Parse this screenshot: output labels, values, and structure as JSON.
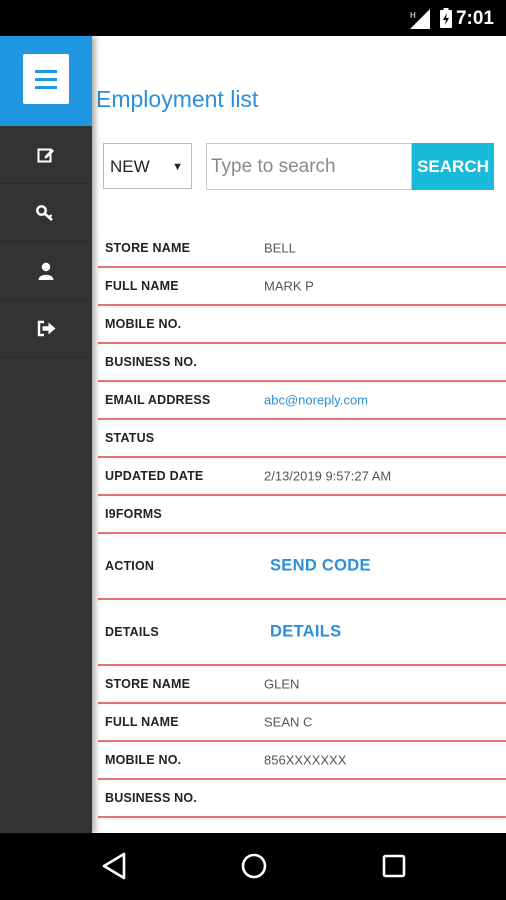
{
  "status_bar": {
    "time": "7:01",
    "icons": [
      "signal-icon",
      "battery-charging-icon"
    ]
  },
  "sidebar": {
    "menu_icon": "hamburger-menu-icon",
    "items": [
      {
        "icon": "edit-icon"
      },
      {
        "icon": "key-icon"
      },
      {
        "icon": "user-icon"
      },
      {
        "icon": "logout-icon"
      }
    ]
  },
  "page": {
    "title": "Employment list",
    "filter": {
      "selected": "NEW"
    },
    "search": {
      "placeholder": "Type to search",
      "value": "",
      "button": "SEARCH"
    }
  },
  "records": [
    {
      "store_label": "STORE NAME",
      "store": "BELL",
      "name_label": "FULL NAME",
      "name": "MARK P",
      "mobile_label": "MOBILE NO.",
      "mobile": "",
      "business_label": "BUSINESS NO.",
      "business": "",
      "email_label": "EMAIL ADDRESS",
      "email": "abc@noreply.com",
      "status_label": "STATUS",
      "status": "",
      "updated_label": "UPDATED DATE",
      "updated": "2/13/2019 9:57:27 AM",
      "i9_label": "I9FORMS",
      "i9": "",
      "action_label": "ACTION",
      "action_link": "SEND CODE",
      "details_label": "DETAILS",
      "details_link": "DETAILS"
    },
    {
      "store_label": "STORE NAME",
      "store": "GLEN",
      "name_label": "FULL NAME",
      "name": "SEAN C",
      "mobile_label": "MOBILE NO.",
      "mobile": "856XXXXXXX",
      "business_label": "BUSINESS NO.",
      "business": ""
    }
  ],
  "colors": {
    "accent": "#2b8fd9",
    "sidebar": "#333333",
    "menu_tile": "#2196e0",
    "search_button": "#19b9d9",
    "row_divider": "#e57373"
  }
}
